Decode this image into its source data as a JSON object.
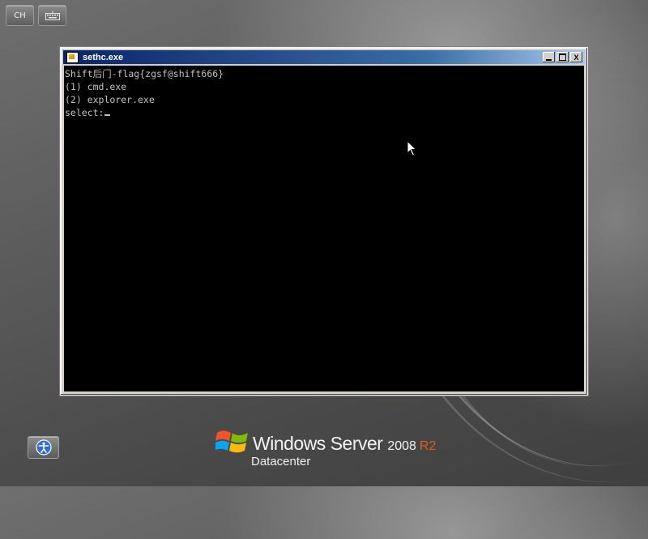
{
  "top_buttons": {
    "language": "CH",
    "keyboard_icon": "keyboard-icon"
  },
  "window": {
    "title": "sethc.exe",
    "controls": {
      "minimize_icon": "minimize-icon",
      "maximize_icon": "maximize-icon",
      "close": "X"
    }
  },
  "console": {
    "lines": [
      "Shift后门-flag{zgsf@shift666}",
      "(1) cmd.exe",
      "(2) explorer.exe"
    ],
    "prompt": "select:"
  },
  "bottom": {
    "access_icon": "ease-of-access-icon"
  },
  "branding": {
    "product": "Windows Server",
    "version": "2008",
    "release": "R2",
    "edition": "Datacenter",
    "colors": {
      "r2": "#e8581a",
      "text": "#f2f2f2"
    }
  }
}
